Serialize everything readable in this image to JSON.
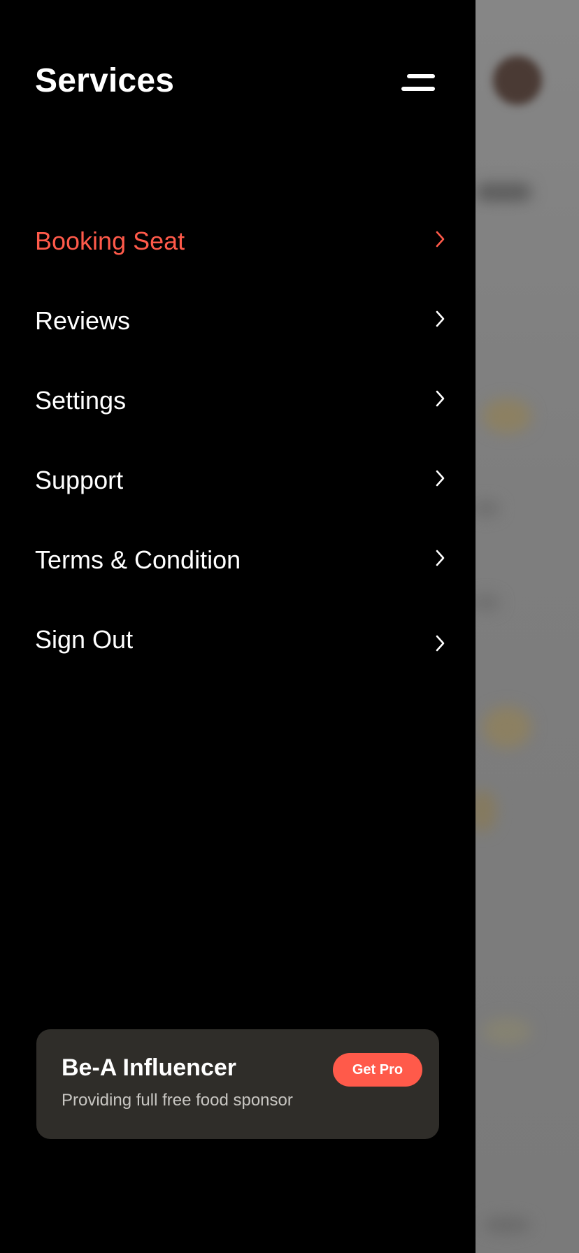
{
  "drawer": {
    "title": "Services",
    "menu_icon": "menu-icon",
    "items": [
      {
        "label": "Booking Seat",
        "active": true,
        "icon": "chevron-right-icon"
      },
      {
        "label": "Reviews",
        "active": false,
        "icon": "chevron-right-icon"
      },
      {
        "label": "Settings",
        "active": false,
        "icon": "chevron-right-icon"
      },
      {
        "label": "Support",
        "active": false,
        "icon": "chevron-right-icon"
      },
      {
        "label": "Terms & Condition",
        "active": false,
        "icon": "chevron-right-icon"
      },
      {
        "label": "Sign Out",
        "active": false,
        "icon": "chevron-right-icon"
      }
    ]
  },
  "promo": {
    "title": "Be-A Influencer",
    "subtitle": "Providing full free food sponsor",
    "button_label": "Get Pro"
  },
  "colors": {
    "accent": "#ff5a4a",
    "drawer_bg": "#000000",
    "card_bg": "#2f2d29",
    "text": "#ffffff"
  }
}
